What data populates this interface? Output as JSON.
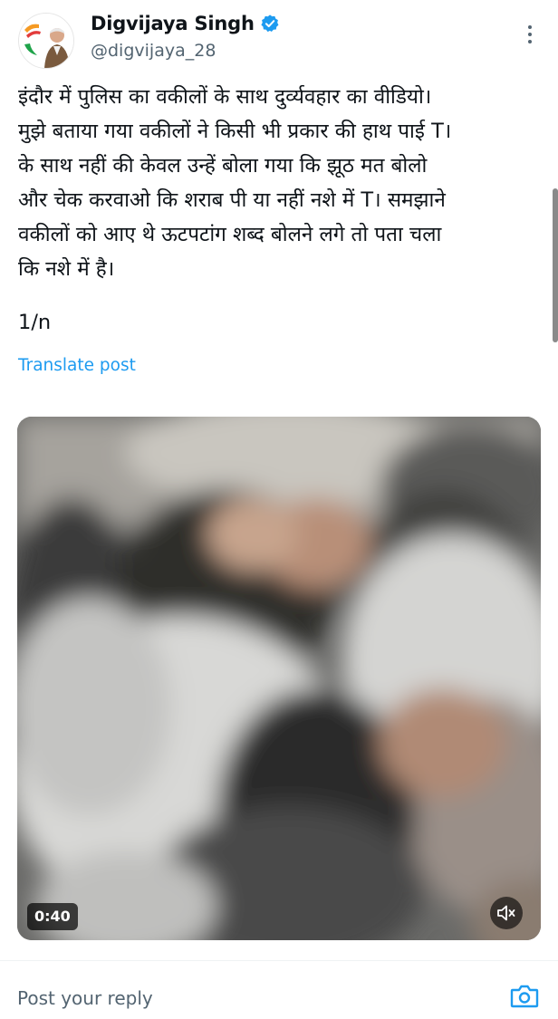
{
  "author": {
    "name": "Digvijaya Singh",
    "handle": "@digvijaya_28",
    "verified_color": "#1d9bf0"
  },
  "post": {
    "text": "इंदौर में पुलिस का वकीलों के साथ दुर्व्यवहार का वीडियो।\nमुझे बताया गया वकीलों ने किसी भी प्रकार की हाथ पाई T।\nके साथ नहीं की केवल उन्हें बोला गया कि झूठ मत बोलो\nऔर चेक करवाओ कि शराब पी या नहीं नशे में T। समझाने\nवकीलों को आए थे ऊटपटांग शब्द बोलने लगे तो पता चला\nकि नशे में है।",
    "thread_count": "1/n",
    "translate_label": "Translate post"
  },
  "video": {
    "duration": "0:40",
    "mute_icon": "speaker-muted-icon"
  },
  "reply": {
    "placeholder": "Post your reply"
  },
  "icons": {
    "more": "more-vertical-icon",
    "camera": "camera-icon",
    "verified": "verified-badge-icon"
  }
}
